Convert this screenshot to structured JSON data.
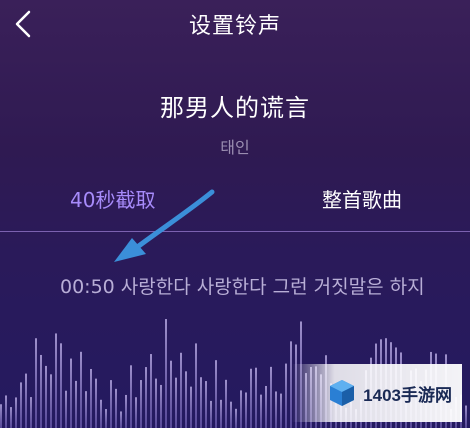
{
  "header": {
    "title": "设置铃声"
  },
  "song": {
    "title": "那男人的谎言",
    "artist": "태인"
  },
  "tabs": [
    {
      "label": "40秒截取",
      "active": true
    },
    {
      "label": "整首歌曲",
      "active": false
    }
  ],
  "lyric": {
    "time": "00:50",
    "text": "사랑한다 사랑한다 그런 거짓말은 하지"
  },
  "watermark": {
    "text": "1403手游网"
  },
  "colors": {
    "accent": "#a78bfa",
    "background": "#2f1a52",
    "arrow": "#3b8fd9"
  }
}
